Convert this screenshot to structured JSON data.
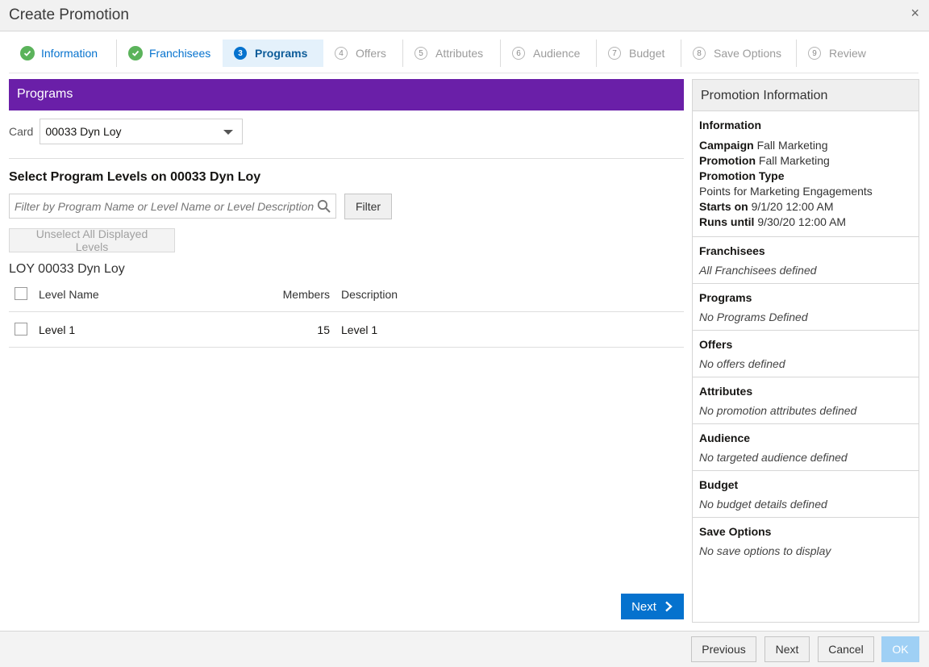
{
  "dialog": {
    "title": "Create Promotion",
    "close": "×"
  },
  "train": {
    "steps": [
      {
        "num": "",
        "label": "Information",
        "state": "done"
      },
      {
        "num": "",
        "label": "Franchisees",
        "state": "done"
      },
      {
        "num": "3",
        "label": "Programs",
        "state": "active"
      },
      {
        "num": "4",
        "label": "Offers",
        "state": "pending"
      },
      {
        "num": "5",
        "label": "Attributes",
        "state": "pending"
      },
      {
        "num": "6",
        "label": "Audience",
        "state": "pending"
      },
      {
        "num": "7",
        "label": "Budget",
        "state": "pending"
      },
      {
        "num": "8",
        "label": "Save Options",
        "state": "pending"
      },
      {
        "num": "9",
        "label": "Review",
        "state": "pending"
      }
    ]
  },
  "programs": {
    "header": "Programs",
    "card_label": "Card",
    "card_value": "00033 Dyn Loy",
    "section_title": "Select Program Levels on 00033 Dyn Loy",
    "filter_placeholder": "Filter by Program Name or Level Name or Level Description",
    "filter_button": "Filter",
    "unselect_button": "Unselect All Displayed Levels",
    "program_name": "LOY 00033 Dyn Loy",
    "columns": {
      "name": "Level Name",
      "members": "Members",
      "description": "Description"
    },
    "rows": [
      {
        "name": "Level 1",
        "members": "15",
        "description": "Level 1"
      }
    ],
    "next_button": "Next"
  },
  "info": {
    "header": "Promotion Information",
    "information": {
      "title": "Information",
      "campaign_label": "Campaign",
      "campaign": "Fall Marketing",
      "promotion_label": "Promotion",
      "promotion": "Fall Marketing",
      "type_label": "Promotion Type",
      "type": "Points for Marketing Engagements",
      "starts_label": "Starts on",
      "starts": "9/1/20 12:00 AM",
      "runs_label": "Runs until",
      "runs": "9/30/20 12:00 AM"
    },
    "sections": [
      {
        "title": "Franchisees",
        "text": "All Franchisees defined"
      },
      {
        "title": "Programs",
        "text": "No Programs Defined"
      },
      {
        "title": "Offers",
        "text": "No offers defined"
      },
      {
        "title": "Attributes",
        "text": "No promotion attributes defined"
      },
      {
        "title": "Audience",
        "text": "No targeted audience defined"
      },
      {
        "title": "Budget",
        "text": "No budget details defined"
      },
      {
        "title": "Save Options",
        "text": "No save options to display"
      }
    ]
  },
  "footer": {
    "previous": "Previous",
    "next": "Next",
    "cancel": "Cancel",
    "ok": "OK"
  },
  "colors": {
    "accent_header": "#6a1fa8",
    "primary": "#0572ce",
    "done": "#5bb35b"
  }
}
